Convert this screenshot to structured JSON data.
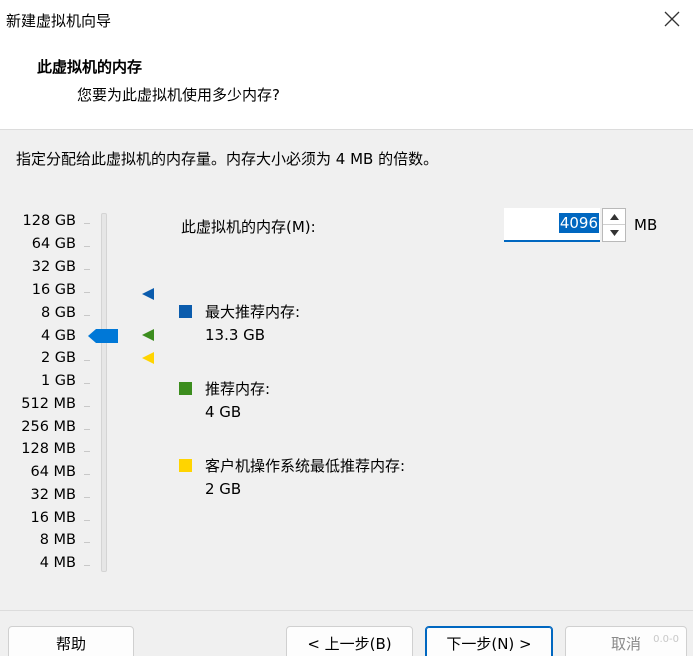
{
  "window": {
    "title": "新建虚拟机向导"
  },
  "header": {
    "title": "此虚拟机的内存",
    "subtitle": "您要为此虚拟机使用多少内存?"
  },
  "instruction": "指定分配给此虚拟机的内存量。内存大小必须为 4 MB 的倍数。",
  "scale": {
    "labels": [
      "128 GB",
      "64 GB",
      "32 GB",
      "16 GB",
      "8 GB",
      "4 GB",
      "2 GB",
      "1 GB",
      "512 MB",
      "256 MB",
      "128 MB",
      "64 MB",
      "32 MB",
      "16 MB",
      "8 MB",
      "4 MB"
    ],
    "selected_label": "4 GB"
  },
  "memory": {
    "label": "此虚拟机的内存(M):",
    "value": "4096",
    "unit": "MB"
  },
  "legend": {
    "max": {
      "title": "最大推荐内存:",
      "value": "13.3 GB",
      "color": "#0b5cad"
    },
    "recommended": {
      "title": "推荐内存:",
      "value": "4 GB",
      "color": "#3c8d1e"
    },
    "min": {
      "title": "客户机操作系统最低推荐内存:",
      "value": "2 GB",
      "color": "#ffd400"
    }
  },
  "buttons": {
    "help": "帮助",
    "back": "< 上一步(B)",
    "next": "下一步(N) >",
    "cancel": "取消"
  },
  "watermark": "0.0-0",
  "colors": {
    "accent": "#0067c0",
    "thumb": "#0078d7"
  }
}
